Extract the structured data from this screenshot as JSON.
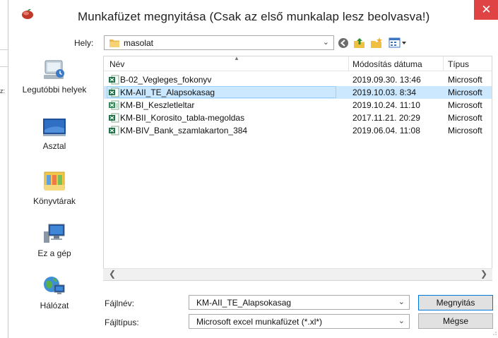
{
  "dialog": {
    "title": "Munkafüzet megnyitása (Csak az első munkalap lesz beolvasva!)",
    "close_glyph": "✕"
  },
  "background": {
    "partial_text": "z:"
  },
  "location": {
    "label": "Hely:",
    "value": "masolat"
  },
  "places": [
    {
      "label": "Legutóbbi helyek",
      "icon": "recent-places-icon"
    },
    {
      "label": "Asztal",
      "icon": "desktop-icon"
    },
    {
      "label": "Könyvtárak",
      "icon": "libraries-icon"
    },
    {
      "label": "Ez a gép",
      "icon": "computer-icon"
    },
    {
      "label": "Hálózat",
      "icon": "network-icon"
    }
  ],
  "file_list": {
    "columns": [
      "Név",
      "Módosítás dátuma",
      "Típus"
    ],
    "rows": [
      {
        "name": "B-02_Vegleges_fokonyv",
        "modified": "2019.09.30. 13:46",
        "type": "Microsoft",
        "selected": false
      },
      {
        "name": "KM-AII_TE_Alapsokasag",
        "modified": "2019.10.03. 8:34",
        "type": "Microsoft",
        "selected": true
      },
      {
        "name": "KM-BI_Keszletleltar",
        "modified": "2019.10.24. 11:10",
        "type": "Microsoft",
        "selected": false
      },
      {
        "name": "KM-BII_Korosito_tabla-megoldas",
        "modified": "2017.11.21. 20:29",
        "type": "Microsoft",
        "selected": false
      },
      {
        "name": "KM-BIV_Bank_szamlakarton_384",
        "modified": "2019.06.04. 11:08",
        "type": "Microsoft",
        "selected": false
      }
    ]
  },
  "filename": {
    "label": "Fájlnév:",
    "value": "KM-AII_TE_Alapsokasag"
  },
  "filetype": {
    "label": "Fájltípus:",
    "value": "Microsoft excel munkafüzet (*.xl*)"
  },
  "buttons": {
    "open": "Megnyitás",
    "cancel": "Mégse"
  },
  "colors": {
    "selection": "#cce8ff",
    "close_button": "#e04343",
    "default_button_border": "#0078d7"
  }
}
